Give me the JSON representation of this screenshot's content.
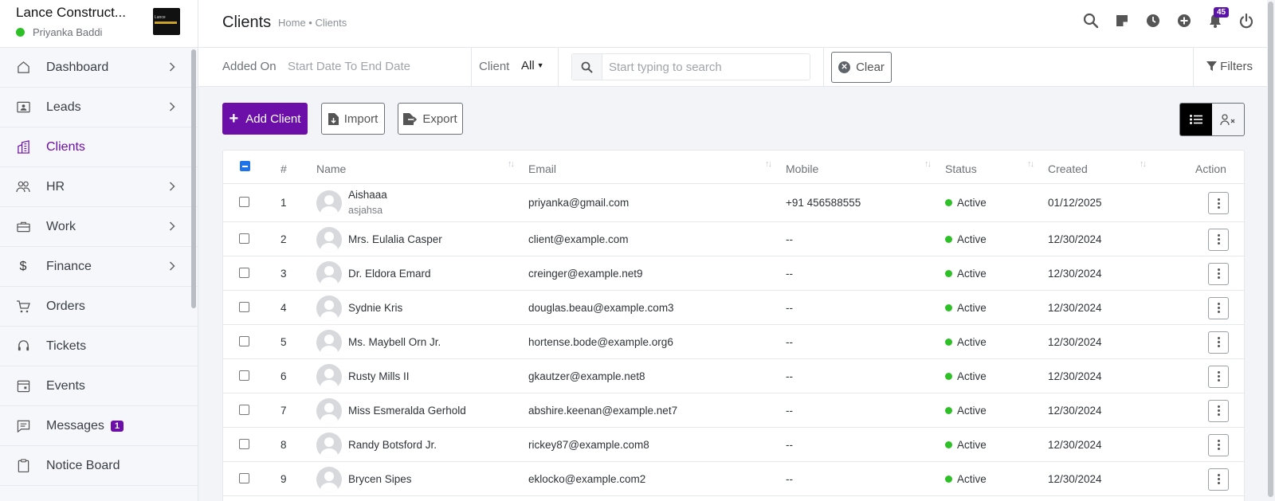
{
  "brand": {
    "name": "Lance Construct...",
    "user": "Priyanka Baddi",
    "logo_text": "Lance"
  },
  "sidebar": {
    "items": [
      {
        "label": "Dashboard",
        "icon": "home-icon",
        "chevron": true
      },
      {
        "label": "Leads",
        "icon": "contact-card-icon",
        "chevron": true
      },
      {
        "label": "Clients",
        "icon": "building-icon",
        "chevron": false,
        "active": true
      },
      {
        "label": "HR",
        "icon": "people-icon",
        "chevron": true
      },
      {
        "label": "Work",
        "icon": "briefcase-icon",
        "chevron": true
      },
      {
        "label": "Finance",
        "icon": "dollar-icon",
        "chevron": true
      },
      {
        "label": "Orders",
        "icon": "cart-icon",
        "chevron": false
      },
      {
        "label": "Tickets",
        "icon": "headset-icon",
        "chevron": false
      },
      {
        "label": "Events",
        "icon": "calendar-icon",
        "chevron": false
      },
      {
        "label": "Messages",
        "icon": "message-icon",
        "chevron": false,
        "badge": "1"
      },
      {
        "label": "Notice Board",
        "icon": "clipboard-icon",
        "chevron": false
      }
    ]
  },
  "header": {
    "title": "Clients",
    "breadcrumb": "Home • Clients",
    "notification_count": "45"
  },
  "filters": {
    "added_on_label": "Added On",
    "date_range": "Start Date To End Date",
    "client_label": "Client",
    "client_value": "All",
    "search_placeholder": "Start typing to search",
    "clear_label": "Clear",
    "filters_label": "Filters"
  },
  "actions": {
    "add_label": "Add Client",
    "import_label": "Import",
    "export_label": "Export"
  },
  "table": {
    "columns": {
      "num": "#",
      "name": "Name",
      "email": "Email",
      "mobile": "Mobile",
      "status": "Status",
      "created": "Created",
      "action": "Action"
    },
    "rows": [
      {
        "num": "1",
        "name": "Aishaaa",
        "sub": "asjahsa",
        "email": "priyanka@gmail.com",
        "mobile": "+91 456588555",
        "status": "Active",
        "created": "01/12/2025"
      },
      {
        "num": "2",
        "name": "Mrs. Eulalia Casper",
        "email": "client@example.com",
        "mobile": "--",
        "status": "Active",
        "created": "12/30/2024"
      },
      {
        "num": "3",
        "name": "Dr. Eldora Emard",
        "email": "creinger@example.net9",
        "mobile": "--",
        "status": "Active",
        "created": "12/30/2024"
      },
      {
        "num": "4",
        "name": "Sydnie Kris",
        "email": "douglas.beau@example.com3",
        "mobile": "--",
        "status": "Active",
        "created": "12/30/2024"
      },
      {
        "num": "5",
        "name": "Ms. Maybell Orn Jr.",
        "email": "hortense.bode@example.org6",
        "mobile": "--",
        "status": "Active",
        "created": "12/30/2024"
      },
      {
        "num": "6",
        "name": "Rusty Mills II",
        "email": "gkautzer@example.net8",
        "mobile": "--",
        "status": "Active",
        "created": "12/30/2024"
      },
      {
        "num": "7",
        "name": "Miss Esmeralda Gerhold",
        "email": "abshire.keenan@example.net7",
        "mobile": "--",
        "status": "Active",
        "created": "12/30/2024"
      },
      {
        "num": "8",
        "name": "Randy Botsford Jr.",
        "email": "rickey87@example.com8",
        "mobile": "--",
        "status": "Active",
        "created": "12/30/2024"
      },
      {
        "num": "9",
        "name": "Brycen Sipes",
        "email": "eklocko@example.com2",
        "mobile": "--",
        "status": "Active",
        "created": "12/30/2024"
      }
    ]
  },
  "colors": {
    "accent": "#6b0fa8",
    "active_status": "#2ec027",
    "checkbox_blue": "#1e73e8"
  }
}
